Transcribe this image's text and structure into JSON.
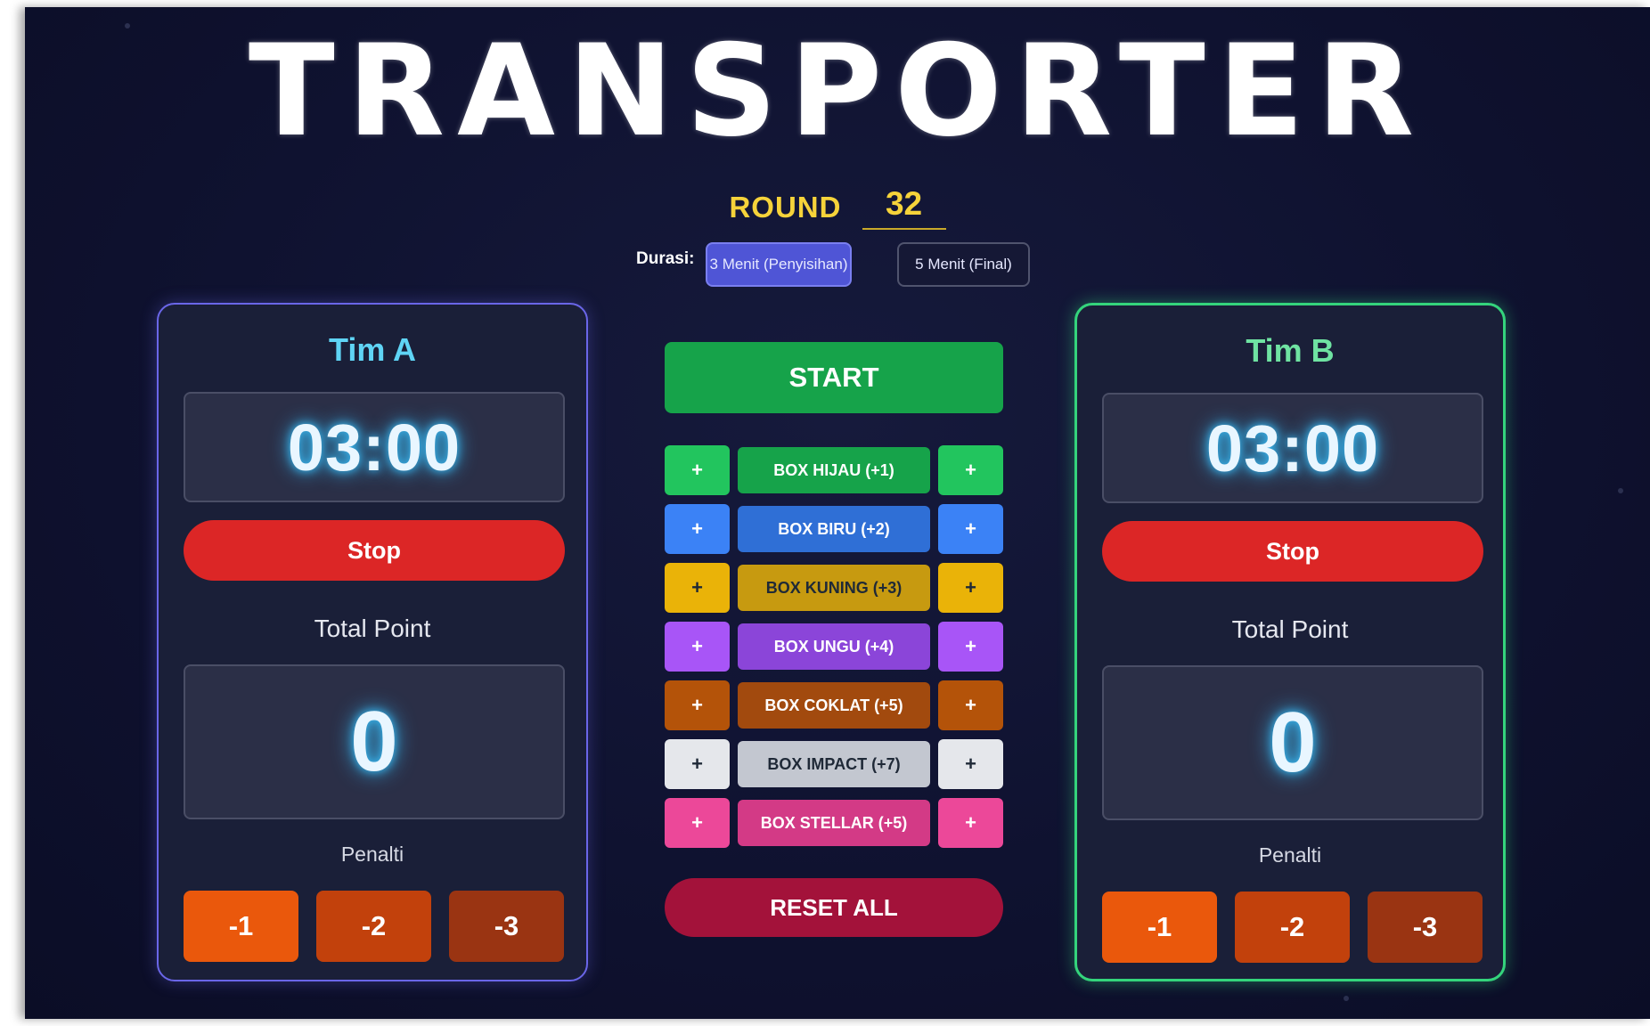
{
  "app": {
    "title": "TRANSPORTER"
  },
  "round": {
    "label": "ROUND",
    "value": "32"
  },
  "duration": {
    "label": "Durasi:",
    "options": [
      "3 Menit (Penyisihan)",
      "5 Menit (Final)"
    ],
    "selected": "3 Menit (Penyisihan)"
  },
  "teams": [
    {
      "name": "Tim A",
      "timer": "03:00",
      "stop_label": "Stop",
      "total_label": "Total Point",
      "score": "0",
      "penalty_label": "Penalti",
      "penalties": [
        "-1",
        "-2",
        "-3"
      ],
      "accent": "#6a66e8"
    },
    {
      "name": "Tim B",
      "timer": "03:00",
      "stop_label": "Stop",
      "total_label": "Total Point",
      "score": "0",
      "penalty_label": "Penalti",
      "penalties": [
        "-1",
        "-2",
        "-3"
      ],
      "accent": "#34d47c"
    }
  ],
  "controls": {
    "start_label": "START",
    "reset_label": "RESET ALL",
    "plus_symbol": "+",
    "boxes": [
      {
        "label": "BOX HIJAU (+1)",
        "btn_color": "#22c55e",
        "label_color": "#16a34a",
        "text_color": "#ffffff"
      },
      {
        "label": "BOX BIRU (+2)",
        "btn_color": "#3b82f6",
        "label_color": "#2f6fd6",
        "text_color": "#ffffff"
      },
      {
        "label": "BOX KUNING (+3)",
        "btn_color": "#eab308",
        "label_color": "#c79a10",
        "text_color": "#1f2937"
      },
      {
        "label": "BOX UNGU (+4)",
        "btn_color": "#a855f7",
        "label_color": "#8b45d9",
        "text_color": "#ffffff"
      },
      {
        "label": "BOX COKLAT (+5)",
        "btn_color": "#b45309",
        "label_color": "#a24a0e",
        "text_color": "#ffffff"
      },
      {
        "label": "BOX IMPACT (+7)",
        "btn_color": "#e5e7eb",
        "label_color": "#c3c7d0",
        "text_color": "#1f2937"
      },
      {
        "label": "BOX STELLAR (+5)",
        "btn_color": "#ec4899",
        "label_color": "#d33a86",
        "text_color": "#ffffff"
      }
    ]
  }
}
